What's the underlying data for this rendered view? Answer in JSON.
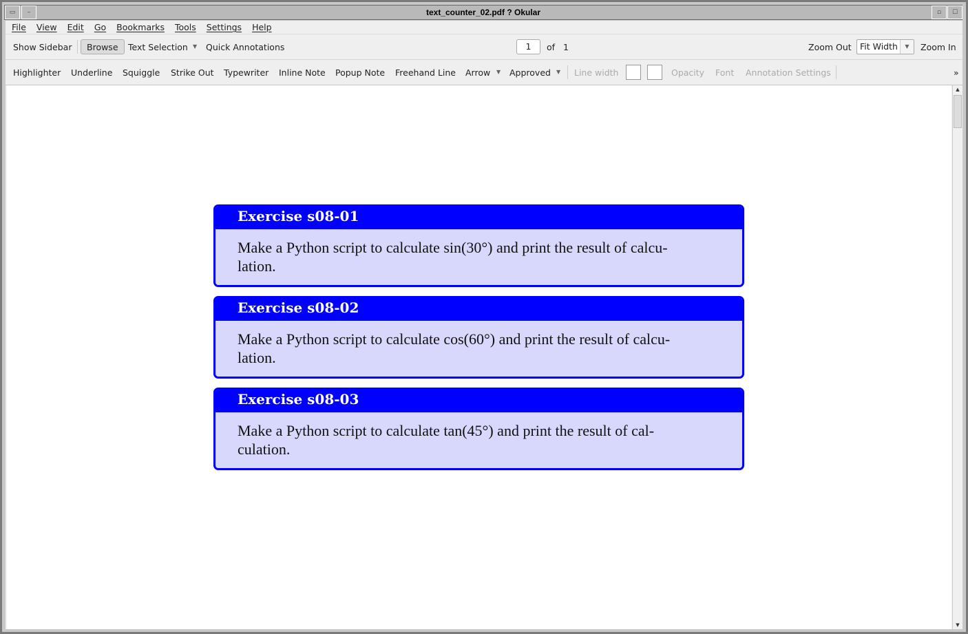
{
  "window": {
    "title": "text_counter_02.pdf  ? Okular"
  },
  "menu": [
    "File",
    "View",
    "Edit",
    "Go",
    "Bookmarks",
    "Tools",
    "Settings",
    "Help"
  ],
  "toolbar": {
    "show_sidebar": "Show Sidebar",
    "browse": "Browse",
    "text_selection": "Text Selection",
    "quick_annotations": "Quick Annotations",
    "page_current": "1",
    "of_label": "of",
    "page_total": "1",
    "zoom_out": "Zoom Out",
    "zoom_mode": "Fit Width",
    "zoom_in": "Zoom In"
  },
  "annot_toolbar": {
    "items": [
      "Highlighter",
      "Underline",
      "Squiggle",
      "Strike Out",
      "Typewriter",
      "Inline Note",
      "Popup Note",
      "Freehand Line",
      "Arrow",
      "Approved"
    ],
    "line_width": "Line width",
    "opacity": "Opacity",
    "font": "Font",
    "settings": "Annotation Settings",
    "overflow": "»"
  },
  "document": {
    "exercises": [
      {
        "title": "Exercise s08-01",
        "line1": "Make a Python script to calculate sin(30°) and print the result of calcu-",
        "line2": "lation."
      },
      {
        "title": "Exercise s08-02",
        "line1": "Make a Python script to calculate cos(60°) and print the result of calcu-",
        "line2": "lation."
      },
      {
        "title": "Exercise s08-03",
        "line1": "Make a Python script to calculate tan(45°) and print the result of cal-",
        "line2": "culation."
      }
    ]
  },
  "colors": {
    "box_border": "#0000ff",
    "box_fill": "#d8d8fc"
  }
}
